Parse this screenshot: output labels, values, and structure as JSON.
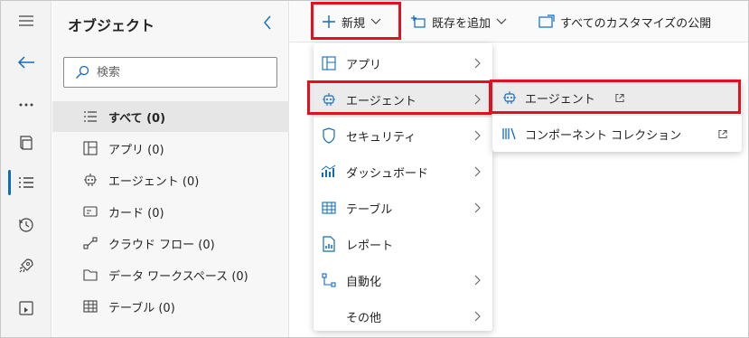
{
  "panel": {
    "title": "オブジェクト",
    "search_placeholder": "検索",
    "items": [
      {
        "label": "すべて (0)",
        "icon": "list-icon"
      },
      {
        "label": "アプリ (0)",
        "icon": "app-icon"
      },
      {
        "label": "エージェント (0)",
        "icon": "agent-icon"
      },
      {
        "label": "カード (0)",
        "icon": "card-icon"
      },
      {
        "label": "クラウド フロー (0)",
        "icon": "flow-icon"
      },
      {
        "label": "データ ワークスペース (0)",
        "icon": "folder-icon"
      },
      {
        "label": "テーブル (0)",
        "icon": "table-icon"
      }
    ]
  },
  "toolbar": {
    "new_label": "新規",
    "add_existing_label": "既存を追加",
    "publish_label": "すべてのカスタマイズの公開"
  },
  "new_menu": {
    "items": [
      {
        "label": "アプリ",
        "icon": "app-icon",
        "submenu": true
      },
      {
        "label": "エージェント",
        "icon": "agent-icon",
        "submenu": true
      },
      {
        "label": "セキュリティ",
        "icon": "shield-icon",
        "submenu": true
      },
      {
        "label": "ダッシュボード",
        "icon": "dashboard-icon",
        "submenu": true
      },
      {
        "label": "テーブル",
        "icon": "table-icon",
        "submenu": true
      },
      {
        "label": "レポート",
        "icon": "report-icon",
        "submenu": false
      },
      {
        "label": "自動化",
        "icon": "automation-icon",
        "submenu": true
      },
      {
        "label": "その他",
        "icon": "",
        "submenu": true
      }
    ]
  },
  "agent_submenu": {
    "items": [
      {
        "label": "エージェント",
        "icon": "agent-icon",
        "external": true
      },
      {
        "label": "コンポーネント コレクション",
        "icon": "library-icon",
        "external": true
      }
    ]
  },
  "colors": {
    "accent": "#0f6cbd",
    "highlight": "#e3101d"
  }
}
